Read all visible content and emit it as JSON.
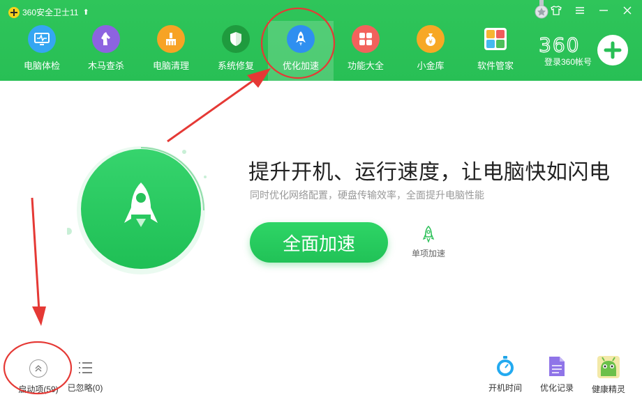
{
  "window": {
    "title": "360安全卫士11",
    "controls": [
      "shirt-icon",
      "menu-icon",
      "minimize-icon",
      "close-icon"
    ]
  },
  "nav": {
    "items": [
      {
        "label": "电脑体检",
        "icon": "monitor-icon",
        "color": "#35a6f2"
      },
      {
        "label": "木马查杀",
        "icon": "horse-icon",
        "color": "#8d63e0"
      },
      {
        "label": "电脑清理",
        "icon": "broom-icon",
        "color": "#f7a325"
      },
      {
        "label": "系统修复",
        "icon": "shield-icon",
        "color": "#1f9b3e"
      },
      {
        "label": "优化加速",
        "icon": "rocket-icon",
        "color": "#2f8ff0",
        "active": true
      },
      {
        "label": "功能大全",
        "icon": "grid-icon",
        "color": "#f2625c"
      },
      {
        "label": "小金库",
        "icon": "moneybag-icon",
        "color": "#f7a825"
      },
      {
        "label": "软件管家",
        "icon": "apps-icon",
        "color": "#4cbf5b"
      }
    ],
    "brand": "360",
    "login_label": "登录360帐号"
  },
  "main": {
    "headline": "提升开机、运行速度，让电脑快如闪电",
    "subline": "同时优化网络配置，硬盘传输效率，全面提升电脑性能",
    "primary_button": "全面加速",
    "secondary_label": "单项加速"
  },
  "bottom_left": {
    "startup_label": "启动项(59)",
    "ignored_label": "已忽略(0)"
  },
  "bottom_right": {
    "tools": [
      {
        "label": "开机时间",
        "icon": "stopwatch-icon"
      },
      {
        "label": "优化记录",
        "icon": "document-icon"
      },
      {
        "label": "健康精灵",
        "icon": "android-sprite-icon"
      }
    ]
  },
  "colors": {
    "header_green": "#28bf55",
    "accent_green": "#21c257",
    "annotation_red": "#e53935"
  }
}
